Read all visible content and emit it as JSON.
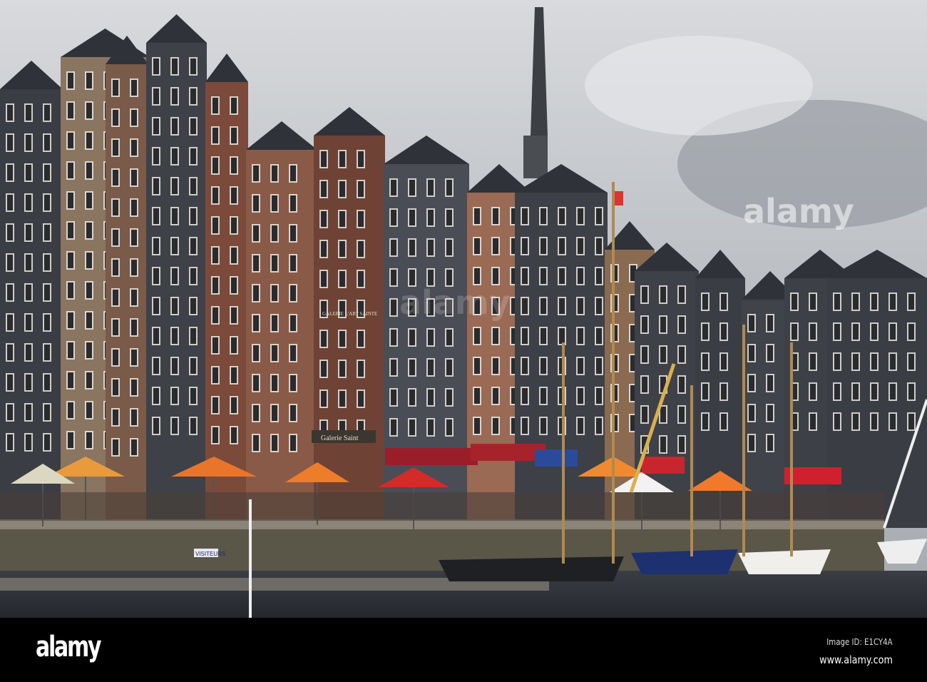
{
  "photo": {
    "watermark": "alamy",
    "sign_visiteurs": "VISITEURS",
    "sign_galerie": "Galerie Saint",
    "sign_facade": "GALERIE L'ART SAINTE"
  },
  "footer": {
    "logo": "alamy",
    "image_id": "Image ID: E1CY4A",
    "url": "www.alamy.com"
  },
  "colors": {
    "sky": "#c9ccd0",
    "umbrella": "#e8752a",
    "awning": "#b3202a",
    "water": "#2d3138"
  }
}
